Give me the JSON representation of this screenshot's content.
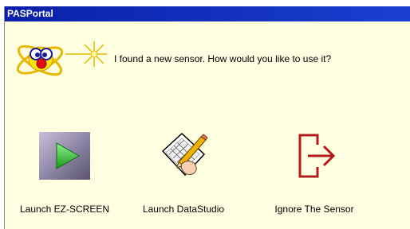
{
  "window": {
    "title": "PASPortal"
  },
  "prompt": {
    "message": "I found a new sensor. How would you like to use it?"
  },
  "options": [
    {
      "label": "Launch EZ-SCREEN",
      "icon": "play-icon"
    },
    {
      "label": "Launch DataStudio",
      "icon": "datastudio-icon"
    },
    {
      "label": "Ignore The Sensor",
      "icon": "exit-door-icon"
    }
  ],
  "colors": {
    "titlebar": "#0a2abf",
    "background": "#ffffe1",
    "ignore_icon": "#b01c1c",
    "play_green": "#2fbf2f"
  }
}
